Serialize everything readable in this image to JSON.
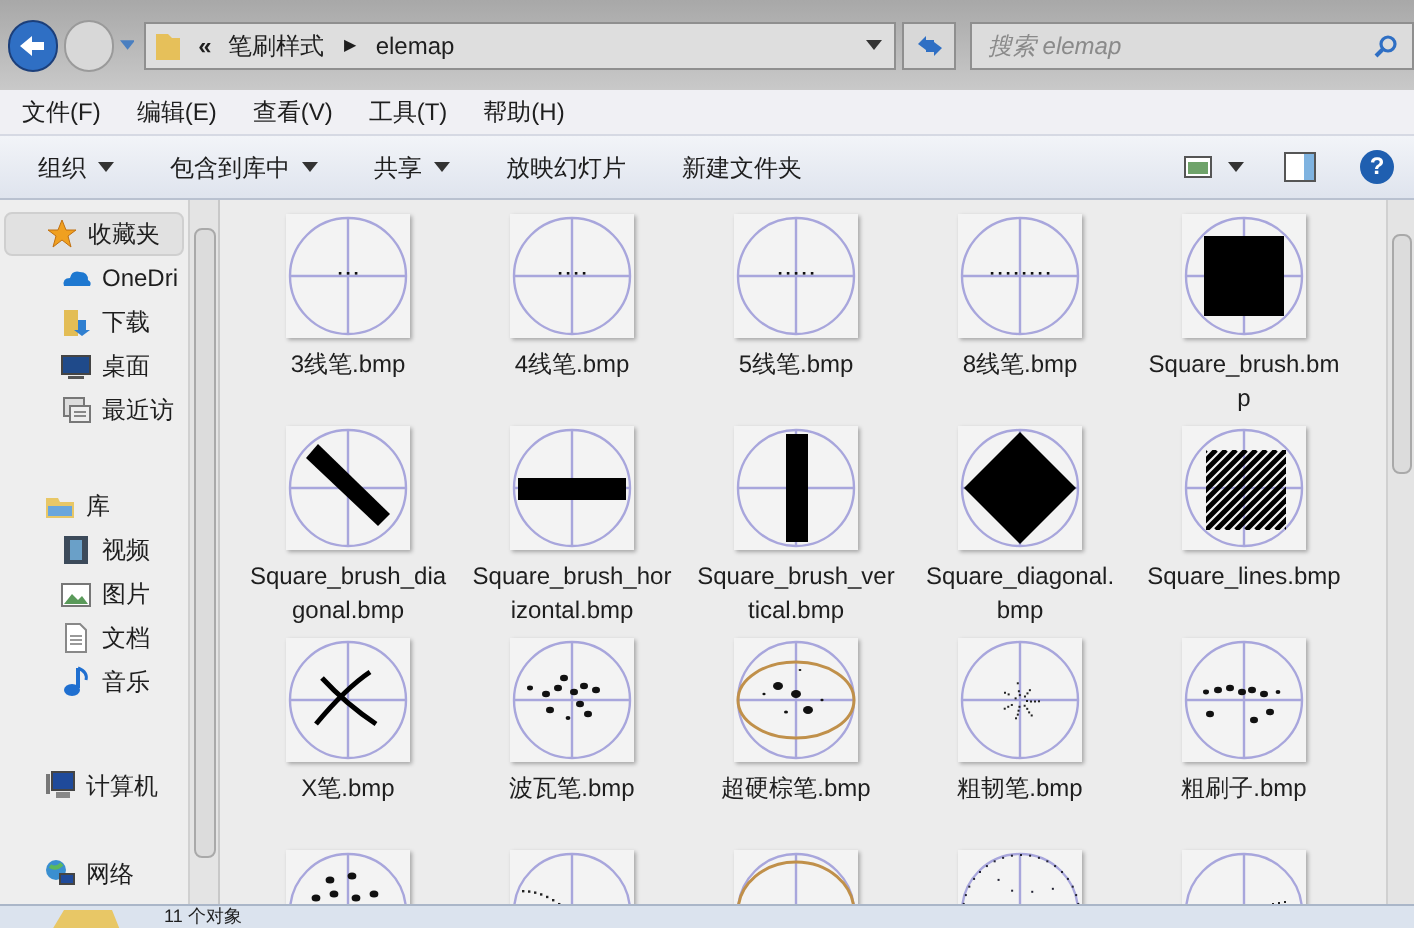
{
  "address_bar": {
    "overflow": "«",
    "crumbs": [
      "笔刷样式",
      "elemap"
    ],
    "separator": "▶"
  },
  "search": {
    "placeholder": "搜索 elemap"
  },
  "menu": [
    "文件(F)",
    "编辑(E)",
    "查看(V)",
    "工具(T)",
    "帮助(H)"
  ],
  "help_button": "?",
  "toolbar": [
    {
      "label": "组织",
      "dropdown": true
    },
    {
      "label": "包含到库中",
      "dropdown": true
    },
    {
      "label": "共享",
      "dropdown": true
    },
    {
      "label": "放映幻灯片",
      "dropdown": false
    },
    {
      "label": "新建文件夹",
      "dropdown": false
    }
  ],
  "sidebar": {
    "groups": [
      {
        "label": "收藏夹",
        "selected": true,
        "children": [
          {
            "label": "OneDri",
            "selected": false
          },
          {
            "label": "下载",
            "selected": false
          },
          {
            "label": "桌面",
            "selected": false
          },
          {
            "label": "最近访",
            "selected": false
          }
        ]
      },
      {
        "label": "库",
        "selected": false,
        "children": [
          {
            "label": "视频",
            "selected": false
          },
          {
            "label": "图片",
            "selected": false
          },
          {
            "label": "文档",
            "selected": false
          },
          {
            "label": "音乐",
            "selected": false
          }
        ]
      },
      {
        "label": "计算机",
        "selected": false
      },
      {
        "label": "网络",
        "selected": false
      }
    ]
  },
  "files": [
    {
      "name": "3线笔.bmp",
      "kind": "dots3"
    },
    {
      "name": "4线笔.bmp",
      "kind": "dots4"
    },
    {
      "name": "5线笔.bmp",
      "kind": "dots5"
    },
    {
      "name": "8线笔.bmp",
      "kind": "dots8"
    },
    {
      "name": "Square_brush.bmp",
      "kind": "square"
    },
    {
      "name": "Square_brush_diagonal.bmp",
      "kind": "diagonal"
    },
    {
      "name": "Square_brush_horizontal.bmp",
      "kind": "horizontal"
    },
    {
      "name": "Square_brush_vertical.bmp",
      "kind": "vertical"
    },
    {
      "name": "Square_diagonal.bmp",
      "kind": "diamond"
    },
    {
      "name": "Square_lines.bmp",
      "kind": "lines"
    },
    {
      "name": "X笔.bmp",
      "kind": "x"
    },
    {
      "name": "波瓦笔.bmp",
      "kind": "blobs"
    },
    {
      "name": "超硬棕笔.bmp",
      "kind": "ellipse"
    },
    {
      "name": "粗韧笔.bmp",
      "kind": "spray"
    },
    {
      "name": "粗刷子.bmp",
      "kind": "blobline"
    },
    {
      "kind": "blobs2"
    },
    {
      "kind": "arc"
    },
    {
      "kind": "ellipseline"
    },
    {
      "kind": "dotring"
    },
    {
      "kind": "dotarc"
    }
  ],
  "status_bar": {
    "count": "11 个对象"
  }
}
